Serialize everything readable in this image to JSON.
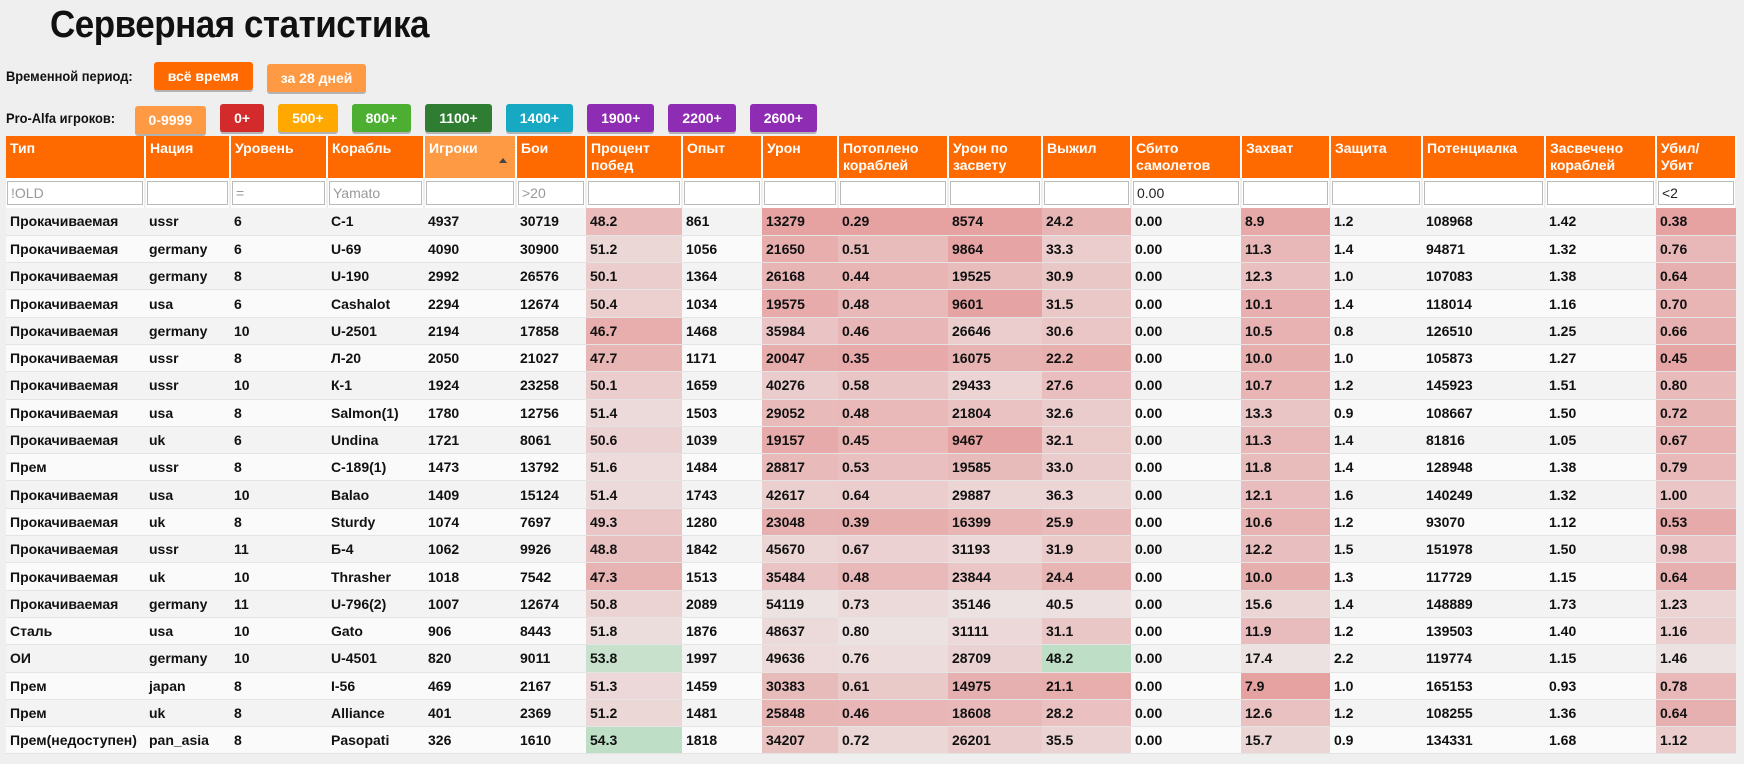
{
  "title": "Серверная статистика",
  "period": {
    "label": "Временной период:",
    "buttons": [
      {
        "label": "всё время",
        "color": "#ff6a00"
      },
      {
        "label": "за 28 дней",
        "color": "#ff9a44"
      }
    ]
  },
  "players": {
    "label": "Pro-Alfa игроков:",
    "buttons": [
      {
        "label": "0-9999",
        "color": "#ff9a44"
      },
      {
        "label": "0+",
        "color": "#d32b2b"
      },
      {
        "label": "500+",
        "color": "#ffa800"
      },
      {
        "label": "800+",
        "color": "#4caf32"
      },
      {
        "label": "1100+",
        "color": "#2e7d32"
      },
      {
        "label": "1400+",
        "color": "#17a9c4"
      },
      {
        "label": "1900+",
        "color": "#8e2cb4"
      },
      {
        "label": "2200+",
        "color": "#8e2cb4"
      },
      {
        "label": "2600+",
        "color": "#8e2cb4"
      }
    ]
  },
  "colors": {
    "header_bg": "#ff6a00",
    "header_sorted_bg": "#ff9a44",
    "cell_red": "#e8a0a0",
    "cell_green": "#c9e6cf"
  },
  "table": {
    "columns": [
      "Тип",
      "Нация",
      "Уровень",
      "Корабль",
      "Игроки",
      "Бои",
      "Процент побед",
      "Опыт",
      "Урон",
      "Потоплено кораблей",
      "Урон по засвету",
      "Выжил",
      "Сбито самолетов",
      "Захват",
      "Защита",
      "Потенциалка",
      "Засвечено кораблей",
      "Убил/ Убит"
    ],
    "sorted_column": "Игроки",
    "filters": [
      {
        "value": "",
        "placeholder": "!OLD"
      },
      {
        "value": "",
        "placeholder": ""
      },
      {
        "value": "",
        "placeholder": "="
      },
      {
        "value": "",
        "placeholder": "Yamato"
      },
      {
        "value": "",
        "placeholder": ""
      },
      {
        "value": "",
        "placeholder": ">20"
      },
      {
        "value": "",
        "placeholder": ""
      },
      {
        "value": "",
        "placeholder": ""
      },
      {
        "value": "",
        "placeholder": ""
      },
      {
        "value": "",
        "placeholder": ""
      },
      {
        "value": "",
        "placeholder": ""
      },
      {
        "value": "",
        "placeholder": ""
      },
      {
        "value": "0.00",
        "placeholder": ""
      },
      {
        "value": "",
        "placeholder": ""
      },
      {
        "value": "",
        "placeholder": ""
      },
      {
        "value": "",
        "placeholder": ""
      },
      {
        "value": "",
        "placeholder": ""
      },
      {
        "value": "<2",
        "placeholder": ""
      }
    ],
    "rows": [
      [
        "Прокачиваемая",
        "ussr",
        "6",
        "С-1",
        "4937",
        "30719",
        "48.2",
        "861",
        "13279",
        "0.29",
        "8574",
        "24.2",
        "0.00",
        "8.9",
        "1.2",
        "108968",
        "1.42",
        "0.38"
      ],
      [
        "Прокачиваемая",
        "germany",
        "6",
        "U-69",
        "4090",
        "30900",
        "51.2",
        "1056",
        "21650",
        "0.51",
        "9864",
        "33.3",
        "0.00",
        "11.3",
        "1.4",
        "94871",
        "1.32",
        "0.76"
      ],
      [
        "Прокачиваемая",
        "germany",
        "8",
        "U-190",
        "2992",
        "26576",
        "50.1",
        "1364",
        "26168",
        "0.44",
        "19525",
        "30.9",
        "0.00",
        "12.3",
        "1.0",
        "107083",
        "1.38",
        "0.64"
      ],
      [
        "Прокачиваемая",
        "usa",
        "6",
        "Cashalot",
        "2294",
        "12674",
        "50.4",
        "1034",
        "19575",
        "0.48",
        "9601",
        "31.5",
        "0.00",
        "10.1",
        "1.4",
        "118014",
        "1.16",
        "0.70"
      ],
      [
        "Прокачиваемая",
        "germany",
        "10",
        "U-2501",
        "2194",
        "17858",
        "46.7",
        "1468",
        "35984",
        "0.46",
        "26646",
        "30.6",
        "0.00",
        "10.5",
        "0.8",
        "126510",
        "1.25",
        "0.66"
      ],
      [
        "Прокачиваемая",
        "ussr",
        "8",
        "Л-20",
        "2050",
        "21027",
        "47.7",
        "1171",
        "20047",
        "0.35",
        "16075",
        "22.2",
        "0.00",
        "10.0",
        "1.0",
        "105873",
        "1.27",
        "0.45"
      ],
      [
        "Прокачиваемая",
        "ussr",
        "10",
        "К-1",
        "1924",
        "23258",
        "50.1",
        "1659",
        "40276",
        "0.58",
        "29433",
        "27.6",
        "0.00",
        "10.7",
        "1.2",
        "145923",
        "1.51",
        "0.80"
      ],
      [
        "Прокачиваемая",
        "usa",
        "8",
        "Salmon(1)",
        "1780",
        "12756",
        "51.4",
        "1503",
        "29052",
        "0.48",
        "21804",
        "32.6",
        "0.00",
        "13.3",
        "0.9",
        "108667",
        "1.50",
        "0.72"
      ],
      [
        "Прокачиваемая",
        "uk",
        "6",
        "Undina",
        "1721",
        "8061",
        "50.6",
        "1039",
        "19157",
        "0.45",
        "9467",
        "32.1",
        "0.00",
        "11.3",
        "1.4",
        "81816",
        "1.05",
        "0.67"
      ],
      [
        "Прем",
        "ussr",
        "8",
        "С-189(1)",
        "1473",
        "13792",
        "51.6",
        "1484",
        "28817",
        "0.53",
        "19585",
        "33.0",
        "0.00",
        "11.8",
        "1.4",
        "128948",
        "1.38",
        "0.79"
      ],
      [
        "Прокачиваемая",
        "usa",
        "10",
        "Balao",
        "1409",
        "15124",
        "51.4",
        "1743",
        "42617",
        "0.64",
        "29887",
        "36.3",
        "0.00",
        "12.1",
        "1.6",
        "140249",
        "1.32",
        "1.00"
      ],
      [
        "Прокачиваемая",
        "uk",
        "8",
        "Sturdy",
        "1074",
        "7697",
        "49.3",
        "1280",
        "23048",
        "0.39",
        "16399",
        "25.9",
        "0.00",
        "10.6",
        "1.2",
        "93070",
        "1.12",
        "0.53"
      ],
      [
        "Прокачиваемая",
        "ussr",
        "11",
        "Б-4",
        "1062",
        "9926",
        "48.8",
        "1842",
        "45670",
        "0.67",
        "31193",
        "31.9",
        "0.00",
        "12.2",
        "1.5",
        "151978",
        "1.50",
        "0.98"
      ],
      [
        "Прокачиваемая",
        "uk",
        "10",
        "Thrasher",
        "1018",
        "7542",
        "47.3",
        "1513",
        "35484",
        "0.48",
        "23844",
        "24.4",
        "0.00",
        "10.0",
        "1.3",
        "117729",
        "1.15",
        "0.64"
      ],
      [
        "Прокачиваемая",
        "germany",
        "11",
        "U-796(2)",
        "1007",
        "12674",
        "50.8",
        "2089",
        "54119",
        "0.73",
        "35146",
        "40.5",
        "0.00",
        "15.6",
        "1.4",
        "148889",
        "1.73",
        "1.23"
      ],
      [
        "Сталь",
        "usa",
        "10",
        "Gato",
        "906",
        "8443",
        "51.8",
        "1876",
        "48637",
        "0.80",
        "31111",
        "31.1",
        "0.00",
        "11.9",
        "1.2",
        "139503",
        "1.40",
        "1.16"
      ],
      [
        "ОИ",
        "germany",
        "10",
        "U-4501",
        "820",
        "9011",
        "53.8",
        "1997",
        "49636",
        "0.76",
        "28709",
        "48.2",
        "0.00",
        "17.4",
        "2.2",
        "119774",
        "1.15",
        "1.46"
      ],
      [
        "Прем",
        "japan",
        "8",
        "I-56",
        "469",
        "2167",
        "51.3",
        "1459",
        "30383",
        "0.61",
        "14975",
        "21.1",
        "0.00",
        "7.9",
        "1.0",
        "165153",
        "0.93",
        "0.78"
      ],
      [
        "Прем",
        "uk",
        "8",
        "Alliance",
        "401",
        "2369",
        "51.2",
        "1481",
        "25848",
        "0.46",
        "18608",
        "28.2",
        "0.00",
        "12.6",
        "1.2",
        "108255",
        "1.36",
        "0.64"
      ],
      [
        "Прем(недоступен)",
        "pan_asia",
        "8",
        "Pasopati",
        "326",
        "1610",
        "54.3",
        "1818",
        "34207",
        "0.72",
        "26201",
        "35.5",
        "0.00",
        "15.7",
        "0.9",
        "134331",
        "1.68",
        "1.12"
      ]
    ]
  }
}
